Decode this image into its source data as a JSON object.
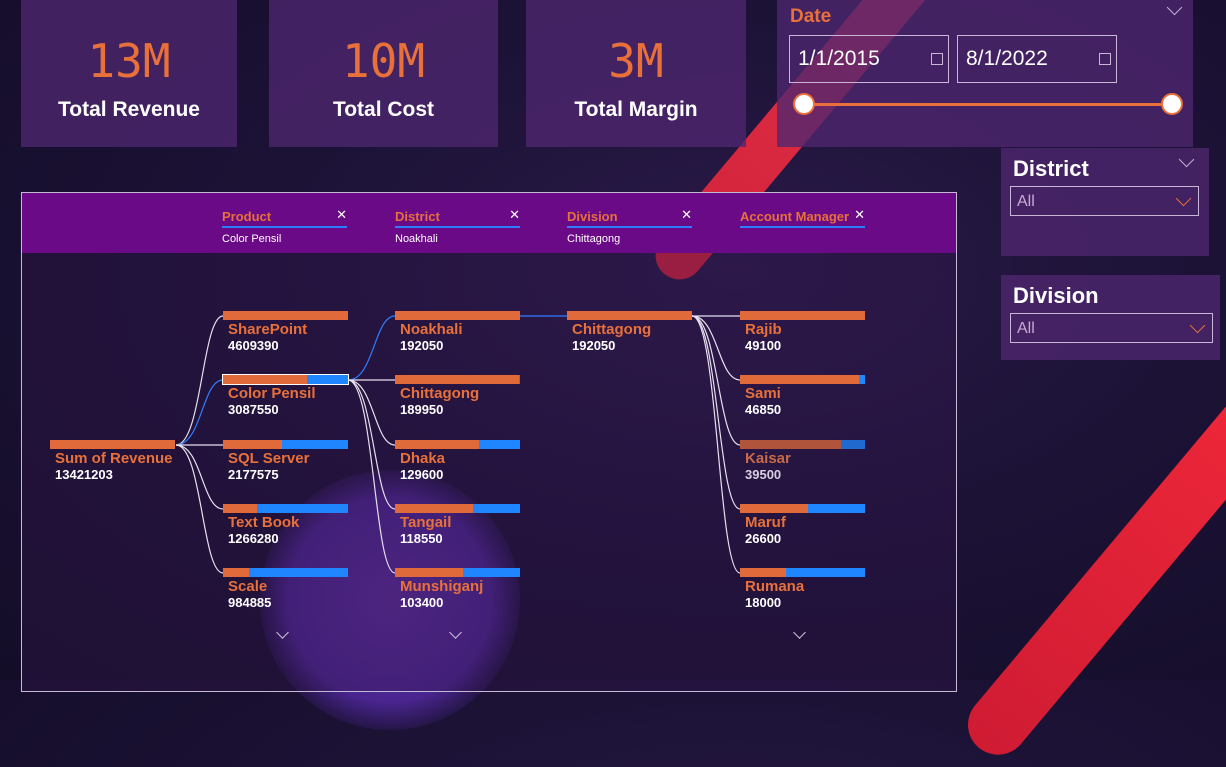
{
  "kpis": [
    {
      "value": "13M",
      "label": "Total Revenue"
    },
    {
      "value": "10M",
      "label": "Total Cost"
    },
    {
      "value": "3M",
      "label": "Total Margin"
    }
  ],
  "date_slicer": {
    "title": "Date",
    "start": "1/1/2015",
    "end": "8/1/2022",
    "range_fraction": [
      0,
      1
    ]
  },
  "district_slicer": {
    "title": "District",
    "selected": "All"
  },
  "division_slicer": {
    "title": "Division",
    "selected": "All"
  },
  "decomposition_tree": {
    "filters": [
      {
        "field": "Product",
        "value": "Color Pensil"
      },
      {
        "field": "District",
        "value": "Noakhali"
      },
      {
        "field": "Division",
        "value": "Chittagong"
      },
      {
        "field": "Account Manager",
        "value": ""
      }
    ],
    "root": {
      "label": "Sum of Revenue",
      "value": "13421203"
    },
    "levels": [
      {
        "field": "Product",
        "nodes": [
          {
            "label": "SharePoint",
            "value": "4609390"
          },
          {
            "label": "Color Pensil",
            "value": "3087550",
            "selected": true
          },
          {
            "label": "SQL Server",
            "value": "2177575"
          },
          {
            "label": "Text Book",
            "value": "1266280"
          },
          {
            "label": "Scale",
            "value": "984885"
          }
        ]
      },
      {
        "field": "District",
        "nodes": [
          {
            "label": "Noakhali",
            "value": "192050",
            "selected": true
          },
          {
            "label": "Chittagong",
            "value": "189950"
          },
          {
            "label": "Dhaka",
            "value": "129600"
          },
          {
            "label": "Tangail",
            "value": "118550"
          },
          {
            "label": "Munshiganj",
            "value": "103400"
          }
        ]
      },
      {
        "field": "Division",
        "nodes": [
          {
            "label": "Chittagong",
            "value": "192050",
            "selected": true
          }
        ]
      },
      {
        "field": "Account Manager",
        "nodes": [
          {
            "label": "Rajib",
            "value": "49100"
          },
          {
            "label": "Sami",
            "value": "46850"
          },
          {
            "label": "Kaisar",
            "value": "39500",
            "dim": true
          },
          {
            "label": "Maruf",
            "value": "26600"
          },
          {
            "label": "Rumana",
            "value": "18000"
          }
        ]
      }
    ]
  },
  "colors": {
    "accent_orange": "#e8703a",
    "bar_blue": "#1f86ff",
    "header_purple": "#6a0a86",
    "card_purple": "#4e2670",
    "stripe_red": "#ff3a4a"
  }
}
